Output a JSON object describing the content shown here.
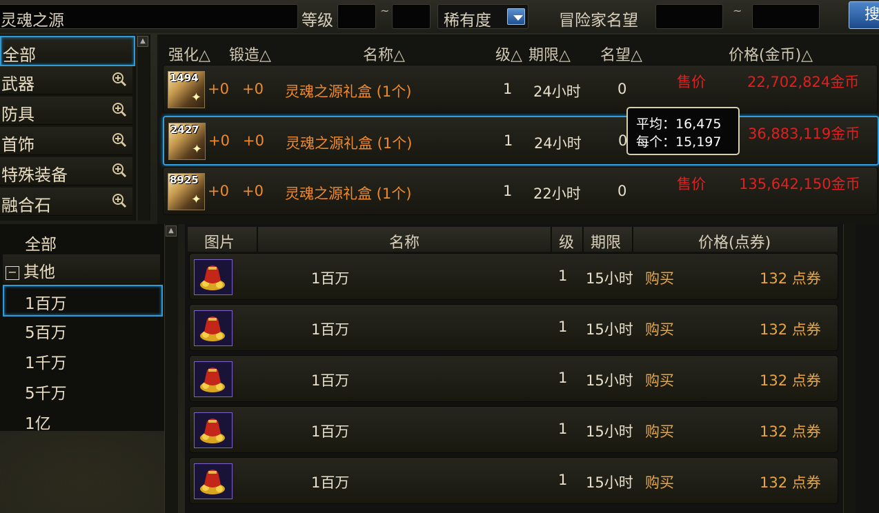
{
  "search": {
    "query": "灵魂之源",
    "level_label": "等级",
    "level_min": "",
    "level_max": "",
    "range_sep": "~",
    "rarity_label": "稀有度",
    "reputation_label": "冒险家名望",
    "reputation_min": "",
    "reputation_max": "",
    "search_button": "搜"
  },
  "categories": [
    {
      "label": "全部",
      "selected": true,
      "expandable": false
    },
    {
      "label": "武器",
      "selected": false,
      "expandable": true
    },
    {
      "label": "防具",
      "selected": false,
      "expandable": true
    },
    {
      "label": "首饰",
      "selected": false,
      "expandable": true
    },
    {
      "label": "特殊装备",
      "selected": false,
      "expandable": true
    },
    {
      "label": "融合石",
      "selected": false,
      "expandable": true
    }
  ],
  "auction": {
    "headers": {
      "enhance": "强化△",
      "forge": "锻造△",
      "name": "名称△",
      "level": "级△",
      "expiry": "期限△",
      "reputation": "名望△",
      "price": "价格(金币)△"
    },
    "rows": [
      {
        "quantity": "1494",
        "enhance": "+0",
        "forge": "+0",
        "name": "灵魂之源礼盒 (1个)",
        "level": "1",
        "expiry": "24小时",
        "reputation": "0",
        "price_label": "售价",
        "price": "22,702,824金币",
        "selected": false
      },
      {
        "quantity": "2427",
        "enhance": "+0",
        "forge": "+0",
        "name": "灵魂之源礼盒 (1个)",
        "level": "1",
        "expiry": "24小时",
        "reputation": "0",
        "price_label": "",
        "price": "36,883,119金币",
        "selected": true
      },
      {
        "quantity": "8925",
        "enhance": "+0",
        "forge": "+0",
        "name": "灵魂之源礼盒 (1个)",
        "level": "1",
        "expiry": "22小时",
        "reputation": "0",
        "price_label": "售价",
        "price": "135,642,150金币",
        "selected": false
      }
    ],
    "tooltip": {
      "average": "平均：16,475",
      "per_unit": "每个：15,197"
    }
  },
  "shop": {
    "tree": [
      {
        "label": "全部",
        "kind": "root",
        "selected": false
      },
      {
        "label": "其他",
        "kind": "group",
        "selected": false
      },
      {
        "label": "1百万",
        "kind": "leaf",
        "selected": true
      },
      {
        "label": "5百万",
        "kind": "leaf",
        "selected": false
      },
      {
        "label": "1千万",
        "kind": "leaf",
        "selected": false
      },
      {
        "label": "5千万",
        "kind": "leaf",
        "selected": false
      },
      {
        "label": "1亿",
        "kind": "leaf",
        "selected": false
      }
    ],
    "collapse_symbol": "−",
    "headers": {
      "image": "图片",
      "name": "名称",
      "level": "级",
      "expiry": "期限",
      "price": "价格(点券)"
    },
    "rows": [
      {
        "name": "1百万",
        "level": "1",
        "expiry": "15小时",
        "action": "购买",
        "price": "132 点券"
      },
      {
        "name": "1百万",
        "level": "1",
        "expiry": "15小时",
        "action": "购买",
        "price": "132 点券"
      },
      {
        "name": "1百万",
        "level": "1",
        "expiry": "15小时",
        "action": "购买",
        "price": "132 点券"
      },
      {
        "name": "1百万",
        "level": "1",
        "expiry": "15小时",
        "action": "购买",
        "price": "132 点券"
      },
      {
        "name": "1百万",
        "level": "1",
        "expiry": "15小时",
        "action": "购买",
        "price": "132 点券"
      }
    ]
  },
  "colors": {
    "selection_border": "#2e9ad6",
    "item_name": "#f08a2e",
    "price_red": "#e02020",
    "buy_gold": "#e9a542"
  }
}
